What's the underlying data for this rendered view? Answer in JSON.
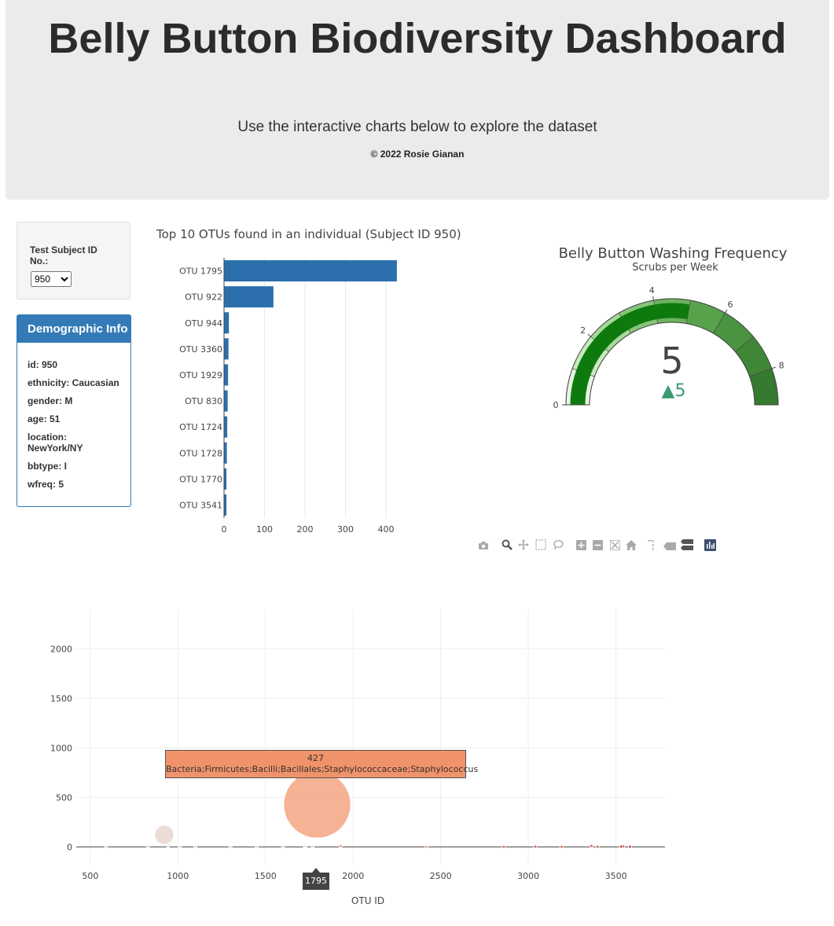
{
  "header": {
    "title": "Belly Button Biodiversity Dashboard",
    "subtitle": "Use the interactive charts below to explore the dataset",
    "copyright": "© 2022 Rosie Gianan"
  },
  "selector": {
    "label": "Test Subject ID No.:",
    "selected": "950"
  },
  "demographics": {
    "heading": "Demographic Info",
    "items": [
      "id: 950",
      "ethnicity: Caucasian",
      "gender: M",
      "age: 51",
      "location: NewYork/NY",
      "bbtype: I",
      "wfreq: 5"
    ]
  },
  "bar_chart": {
    "title": "Top 10 OTUs found in an individual (Subject ID 950)",
    "color": "#2b6fad"
  },
  "gauge": {
    "title": "Belly Button Washing Frequency",
    "subtitle": "Scrubs per Week",
    "value": "5",
    "delta": "▲5",
    "range": [
      0,
      9
    ],
    "ticks": [
      "0",
      "2",
      "4",
      "6",
      "8"
    ],
    "band_colors": [
      "#e6f5e1",
      "#c8eac0",
      "#a6d89b",
      "#86c57a",
      "#6cb35f",
      "#58a24c",
      "#4a9341",
      "#3f8637",
      "#357a2e"
    ],
    "bar_color": "#0e7a0e",
    "delta_color": "#3d9970"
  },
  "modebar": {
    "icons": [
      "camera-icon",
      "zoom-icon",
      "pan-icon",
      "box-select-icon",
      "lasso-icon",
      "zoom-in-icon",
      "zoom-out-icon",
      "autoscale-icon",
      "home-icon",
      "spike-lines-icon",
      "hover-closest-icon",
      "hover-compare-icon",
      "plotly-logo-icon"
    ]
  },
  "bubble_chart": {
    "xlabel": "OTU ID",
    "tooltip_value": "427",
    "tooltip_label": "Bacteria;Firmicutes;Bacilli;Bacillales;Staphylococcaceae;Staphylococcus",
    "hover_x_label": "1795"
  },
  "chart_data": [
    {
      "type": "bar",
      "orientation": "horizontal",
      "title": "Top 10 OTUs found in an individual (Subject ID 950)",
      "categories": [
        "OTU 1795",
        "OTU 922",
        "OTU 944",
        "OTU 3360",
        "OTU 1929",
        "OTU 830",
        "OTU 1724",
        "OTU 1728",
        "OTU 1770",
        "OTU 3541"
      ],
      "values": [
        427,
        122,
        12,
        11,
        10,
        9,
        8,
        7,
        6,
        6
      ],
      "xlim": [
        0,
        440
      ],
      "xticks": [
        0,
        100,
        200,
        300,
        400
      ]
    },
    {
      "type": "scatter",
      "xlabel": "OTU ID",
      "xlim": [
        420,
        3780
      ],
      "ylim": [
        -180,
        2400
      ],
      "xticks": [
        500,
        1000,
        1500,
        2000,
        2500,
        3000,
        3500
      ],
      "yticks": [
        0,
        500,
        1000,
        1500,
        2000
      ],
      "points": [
        {
          "x": 1795,
          "y": 427,
          "size": 427,
          "color": "#f4a582",
          "opacity": 0.85
        },
        {
          "x": 922,
          "y": 122,
          "size": 122,
          "color": "#e8d3cc",
          "opacity": 0.8
        },
        {
          "x": 944,
          "y": 12,
          "size": 12,
          "color": "#ecdcd5",
          "opacity": 0.9
        },
        {
          "x": 830,
          "y": 9,
          "size": 9,
          "color": "#ecdcd5",
          "opacity": 0.9
        },
        {
          "x": 1929,
          "y": 10,
          "size": 10,
          "color": "#f0926a",
          "opacity": 0.9
        },
        {
          "x": 1724,
          "y": 8,
          "size": 8,
          "color": "#f6dccf",
          "opacity": 0.9
        },
        {
          "x": 1728,
          "y": 7,
          "size": 7,
          "color": "#f6dccf",
          "opacity": 0.9
        },
        {
          "x": 1770,
          "y": 6,
          "size": 6,
          "color": "#f6dccf",
          "opacity": 0.9
        },
        {
          "x": 3360,
          "y": 11,
          "size": 11,
          "color": "#d6604d",
          "opacity": 0.9
        },
        {
          "x": 3541,
          "y": 6,
          "size": 6,
          "color": "#c23b3b",
          "opacity": 0.9
        },
        {
          "x": 3530,
          "y": 3,
          "size": 3,
          "color": "#c23b3b",
          "opacity": 0.9
        },
        {
          "x": 3040,
          "y": 3,
          "size": 3,
          "color": "#d6604d",
          "opacity": 0.9
        },
        {
          "x": 3395,
          "y": 2,
          "size": 2,
          "color": "#d6604d",
          "opacity": 0.9
        },
        {
          "x": 3580,
          "y": 2,
          "size": 2,
          "color": "#c23b3b",
          "opacity": 0.9
        },
        {
          "x": 2860,
          "y": 1,
          "size": 1,
          "color": "#e0604d",
          "opacity": 0.9
        },
        {
          "x": 3190,
          "y": 1,
          "size": 1,
          "color": "#e0604d",
          "opacity": 0.9
        },
        {
          "x": 2420,
          "y": 1,
          "size": 1,
          "color": "#f4a582",
          "opacity": 0.9
        },
        {
          "x": 1450,
          "y": 2,
          "size": 2,
          "color": "#f6dccf",
          "opacity": 0.9
        },
        {
          "x": 1300,
          "y": 2,
          "size": 2,
          "color": "#f6dccf",
          "opacity": 0.9
        },
        {
          "x": 1100,
          "y": 2,
          "size": 2,
          "color": "#f6dccf",
          "opacity": 0.9
        },
        {
          "x": 1600,
          "y": 2,
          "size": 2,
          "color": "#f6dccf",
          "opacity": 0.9
        },
        {
          "x": 1010,
          "y": 1,
          "size": 1,
          "color": "#f6dccf",
          "opacity": 0.9
        },
        {
          "x": 590,
          "y": 1,
          "size": 1,
          "color": "#f6dccf",
          "opacity": 0.9
        }
      ]
    },
    {
      "type": "gauge",
      "title": "Belly Button Washing Frequency",
      "subtitle": "Scrubs per Week",
      "value": 5,
      "delta": 5,
      "range": [
        0,
        9
      ]
    }
  ]
}
